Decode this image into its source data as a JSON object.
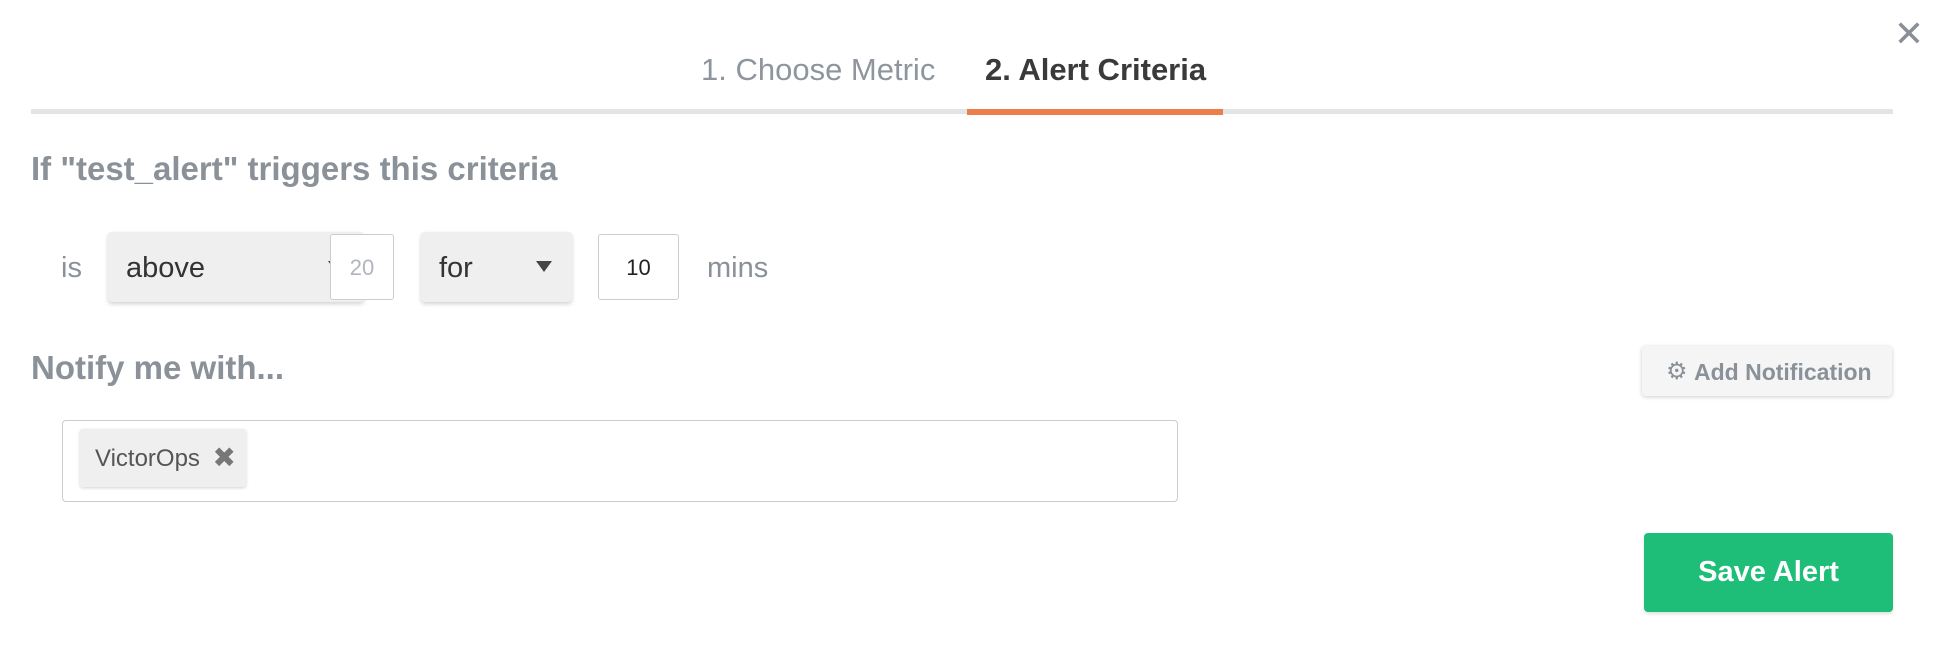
{
  "dialog": {
    "close_icon": "close-icon"
  },
  "tabs": [
    {
      "label": "1. Choose Metric",
      "active": false
    },
    {
      "label": "2. Alert Criteria",
      "active": true
    }
  ],
  "colors": {
    "active_tab_underline": "#ee7d4c",
    "save_button": "#1ebd78",
    "muted_text": "#8a9199"
  },
  "criteria": {
    "title": "If \"test_alert\" triggers this criteria",
    "is_label": "is",
    "comparison_select": "above",
    "threshold_placeholder": "20",
    "window_select": "for",
    "duration_value": "10",
    "unit_label": "mins"
  },
  "notify": {
    "title": "Notify me with...",
    "add_button_label": "Add Notification",
    "add_button_icon": "gear-icon",
    "tags": [
      {
        "label": "VictorOps",
        "remove_icon": "remove-icon"
      }
    ]
  },
  "footer": {
    "save_label": "Save Alert"
  }
}
